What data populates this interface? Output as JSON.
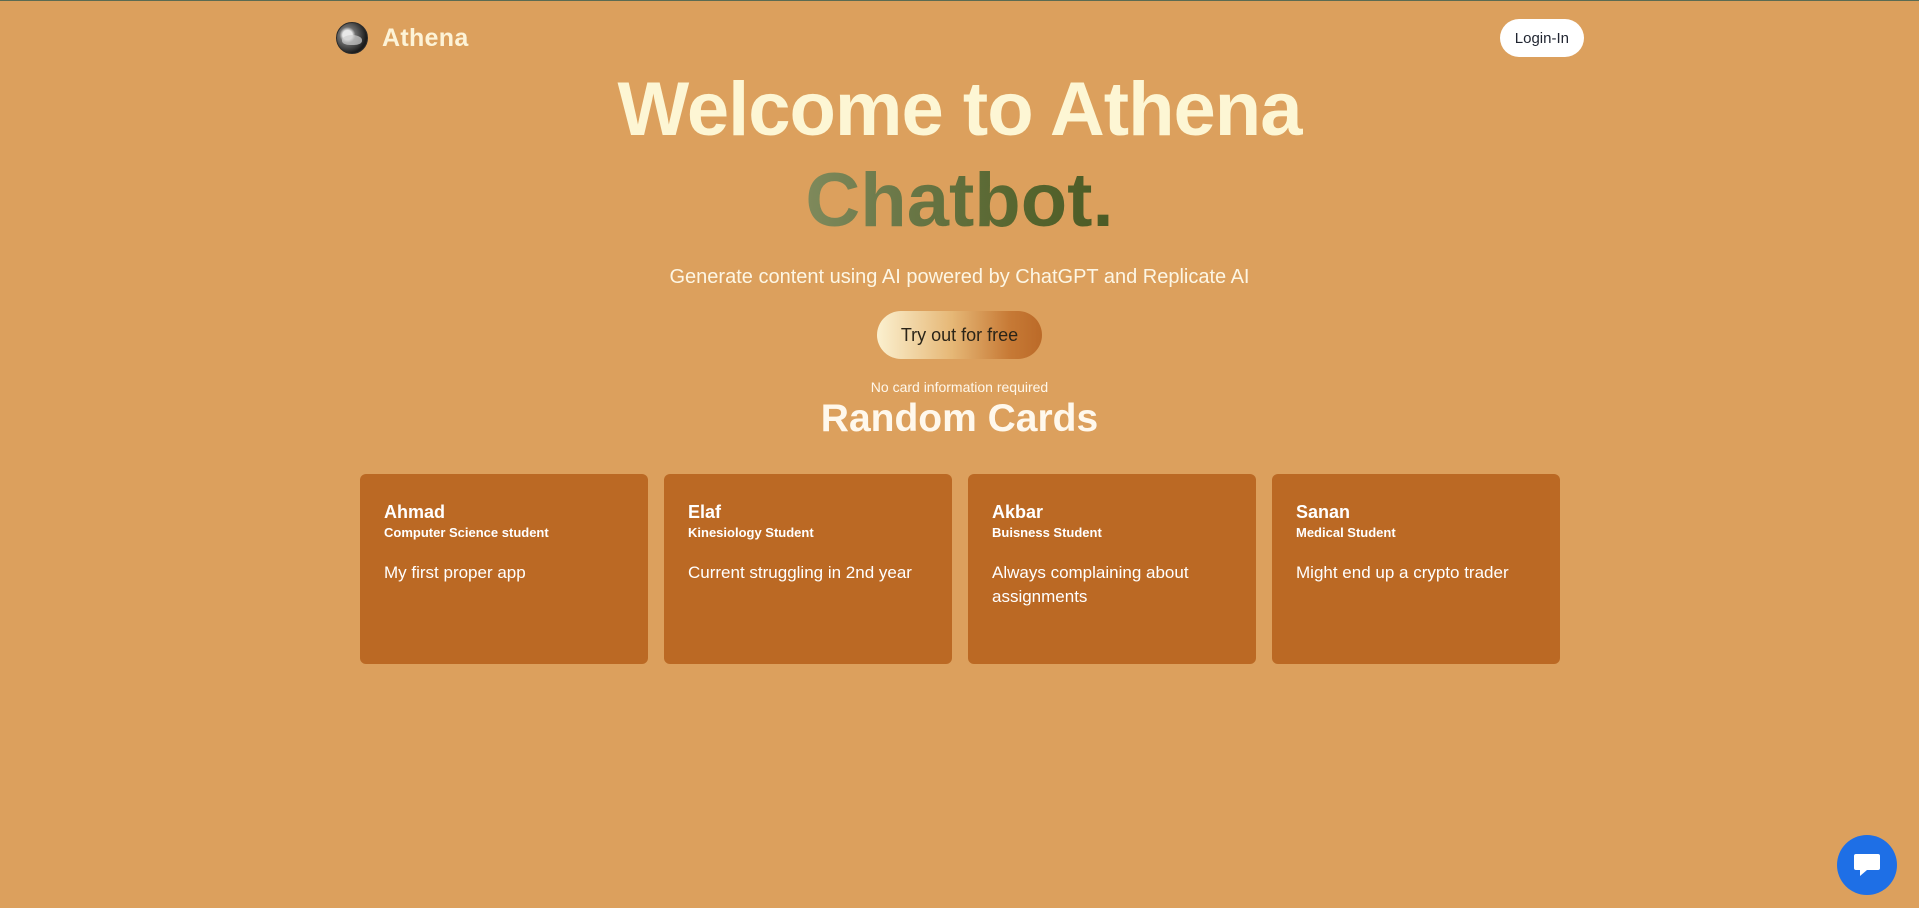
{
  "header": {
    "brand_name": "Athena",
    "login_label": "Login-In"
  },
  "hero": {
    "title": "Welcome to Athena",
    "accent": "Chatbot.",
    "subtitle": "Generate content using AI powered by ChatGPT and Replicate AI",
    "cta_label": "Try out for free",
    "note": "No card information required"
  },
  "section": {
    "title": "Random Cards"
  },
  "cards": [
    {
      "name": "Ahmad",
      "role": "Computer Science student",
      "text": "My first proper app"
    },
    {
      "name": "Elaf",
      "role": "Kinesiology Student",
      "text": "Current struggling in 2nd year"
    },
    {
      "name": "Akbar",
      "role": "Buisness Student",
      "text": "Always complaining about assignments"
    },
    {
      "name": "Sanan",
      "role": "Medical Student",
      "text": "Might end up a crypto trader"
    }
  ],
  "colors": {
    "background": "#dca05d",
    "card": "#bb6924",
    "chat_button": "#1e6fe6"
  },
  "icons": {
    "logo": "athena-logo",
    "chat": "chat-bubble-icon"
  }
}
